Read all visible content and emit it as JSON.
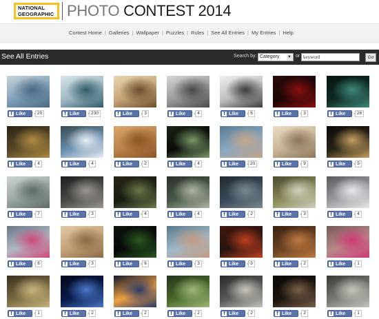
{
  "header": {
    "logo_text": "NATIONAL GEOGRAPHIC",
    "title_light": "PHOTO ",
    "title_dark": "CONTEST ",
    "title_year": "2014",
    "logo_color": "#f7c21a"
  },
  "nav": {
    "items": [
      "Contest Home",
      "Galleries",
      "Wallpaper",
      "Puzzles",
      "Rules",
      "See All Entries",
      "My Entries",
      "Help"
    ]
  },
  "section": {
    "title": "See All Entries",
    "search_label": "Search by:",
    "category_value": "Category",
    "or_label": "or",
    "keyword_value": "keyword",
    "go_label": "Go"
  },
  "like": {
    "label": "Like",
    "icon": "facebook-f-icon",
    "button_color": "#5b74a8"
  },
  "entries": [
    {
      "likes": "20",
      "colors": [
        "#7f9fb8",
        "#4a6a80",
        "#c9d3d9"
      ]
    },
    {
      "likes": "230",
      "colors": [
        "#9fb6c2",
        "#2f5b6a",
        "#d7e4ea"
      ]
    },
    {
      "likes": "3",
      "colors": [
        "#c6a374",
        "#6b4e2f",
        "#e8d6b6"
      ]
    },
    {
      "likes": "4",
      "colors": [
        "#9a9a9a",
        "#4a4a4a",
        "#d6d6d6"
      ]
    },
    {
      "likes": "6",
      "colors": [
        "#bdbdbd",
        "#3c3c3c",
        "#efefef"
      ]
    },
    {
      "likes": "3",
      "colors": [
        "#1a0606",
        "#8c1010",
        "#2a0a0a"
      ]
    },
    {
      "likes": "26",
      "colors": [
        "#0f2a24",
        "#3f8a7a",
        "#071512"
      ]
    },
    {
      "likes": "4",
      "colors": [
        "#5a4a2a",
        "#b08a40",
        "#2a2414"
      ]
    },
    {
      "likes": "4",
      "colors": [
        "#6a8fb0",
        "#e8eef4",
        "#3a4a50"
      ]
    },
    {
      "likes": "2",
      "colors": [
        "#b8804a",
        "#8a5424",
        "#d8a66a"
      ]
    },
    {
      "likes": "4",
      "colors": [
        "#0a0c08",
        "#7a9a6a",
        "#1a2414"
      ]
    },
    {
      "likes": "20",
      "colors": [
        "#8aa8c0",
        "#c4a488",
        "#5a7a94"
      ]
    },
    {
      "likes": "9",
      "colors": [
        "#c8b498",
        "#8c7458",
        "#eadcc6"
      ]
    },
    {
      "likes": "5",
      "colors": [
        "#2a2418",
        "#c8a060",
        "#0c0a08"
      ]
    },
    {
      "likes": "7",
      "colors": [
        "#9aa6a0",
        "#5e6a64",
        "#ccd4cf"
      ]
    },
    {
      "likes": "3",
      "colors": [
        "#4a4a48",
        "#9a9690",
        "#1e1e1c"
      ]
    },
    {
      "likes": "4",
      "colors": [
        "#161c12",
        "#6a7a4a",
        "#2a2418"
      ]
    },
    {
      "likes": "4",
      "colors": [
        "#4a5a4a",
        "#b0b4a4",
        "#2a302a"
      ]
    },
    {
      "likes": "2",
      "colors": [
        "#3a4a5a",
        "#7a8a90",
        "#202a30"
      ]
    },
    {
      "likes": "3",
      "colors": [
        "#8a8a5a",
        "#d0d0c0",
        "#4a4a30"
      ]
    },
    {
      "likes": "4",
      "colors": [
        "#9a9aa0",
        "#e8e8ea",
        "#5a5a60"
      ]
    },
    {
      "likes": "6",
      "colors": [
        "#b0b8c4",
        "#d04878",
        "#6a7888"
      ]
    },
    {
      "likes": "3",
      "colors": [
        "#c4a07a",
        "#8a6a44",
        "#e0c8a4"
      ]
    },
    {
      "likes": "6",
      "colors": [
        "#06080a",
        "#2a5a20",
        "#0e140c"
      ]
    },
    {
      "likes": "3",
      "colors": [
        "#a0b8c8",
        "#c49a80",
        "#5a7888"
      ]
    },
    {
      "likes": "3",
      "colors": [
        "#2a1410",
        "#c04020",
        "#401810"
      ]
    },
    {
      "likes": "2",
      "colors": [
        "#6a4424",
        "#c07840",
        "#3a2010"
      ]
    },
    {
      "likes": "1",
      "colors": [
        "#b88a8a",
        "#d03878",
        "#7a5858"
      ]
    },
    {
      "likes": "1",
      "colors": [
        "#7a6a44",
        "#c8b47a",
        "#3a3020"
      ]
    },
    {
      "likes": "2",
      "colors": [
        "#0a1a4a",
        "#4a78c8",
        "#04081a"
      ]
    },
    {
      "likes": "2",
      "colors": [
        "#f0a040",
        "#2a3a6a",
        "#101830"
      ]
    },
    {
      "likes": "2",
      "colors": [
        "#4a6a2a",
        "#a0b878",
        "#24341a"
      ]
    },
    {
      "likes": "2",
      "colors": [
        "#5a5a58",
        "#c8c4bc",
        "#2a2a28"
      ]
    },
    {
      "likes": "2",
      "colors": [
        "#1a1410",
        "#7a6048",
        "#0a0806"
      ]
    },
    {
      "likes": "1",
      "colors": [
        "#7a7a74",
        "#c4c4bc",
        "#3a3a36"
      ]
    }
  ]
}
